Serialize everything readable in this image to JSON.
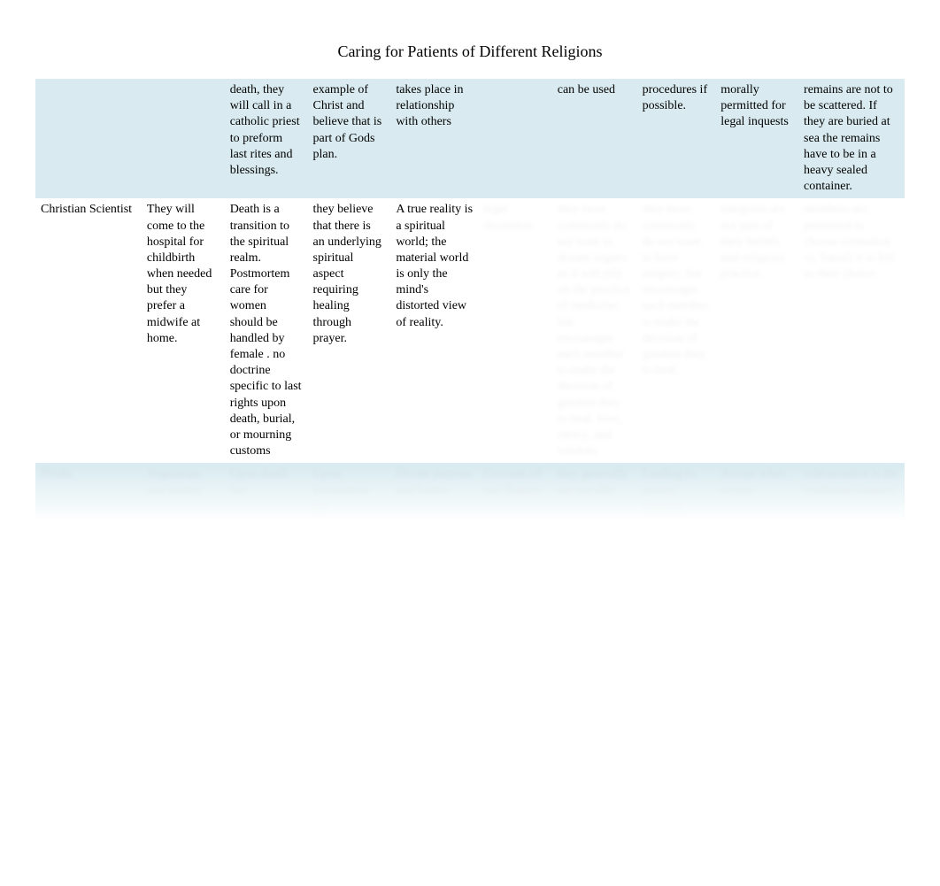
{
  "title": "Caring for Patients of Different Religions",
  "rows": [
    {
      "type": "shaded",
      "cells": [
        "",
        "",
        "death, they will call in a catholic priest to preform last rites and blessings.",
        "example of Christ and believe that is part of Gods plan.",
        "takes place in relationship with others",
        "",
        "can be used",
        "procedures if possible.",
        "morally permitted for legal inquests",
        "remains are not to be scattered. If they are buried at sea the remains have to be in a heavy sealed container."
      ]
    },
    {
      "type": "plain",
      "cells": [
        "Christian Scientist",
        "They will come to the hospital for childbirth when needed but they prefer a midwife at home.",
        "Death is a transition to the spiritual realm. Postmortem care for women should be handled by female . no doctrine specific to last rights upon death, burial, or mourning customs",
        "they believe that there is an underlying spiritual aspect requiring healing through prayer.",
        "A true reality is a spiritual world; the material world is only the mind's distorted view of reality.",
        "",
        "",
        "",
        "",
        ""
      ],
      "blurred_cells": [
        "",
        "",
        "",
        "",
        "",
        "legal discretion",
        "they most commonly do not want to donate organs as it will rely on the practice of medicine; but encourages each member to make the decision of greatest duty to heal, love, mercy, and wisdom.",
        "they most commonly do not want to have surgery; but encourages each member to make the decision of greatest duty to heal.",
        "autopsies are not part of their beliefs and religious practice.",
        "members are permitted to choose cremation vs. burial; it is left as their choice."
      ]
    },
    {
      "type": "shaded",
      "blurred_all": true,
      "cells": [
        "Hindu",
        "Vegetarian and fasting",
        "Upon death last",
        "Upon incarnation the",
        "Divine purpose and karma",
        "Coconut oil and flowers",
        "they generally are not able",
        "Leading to prayer; decision",
        "Accept when accept",
        "reincarnation is the continued journey;"
      ]
    }
  ]
}
